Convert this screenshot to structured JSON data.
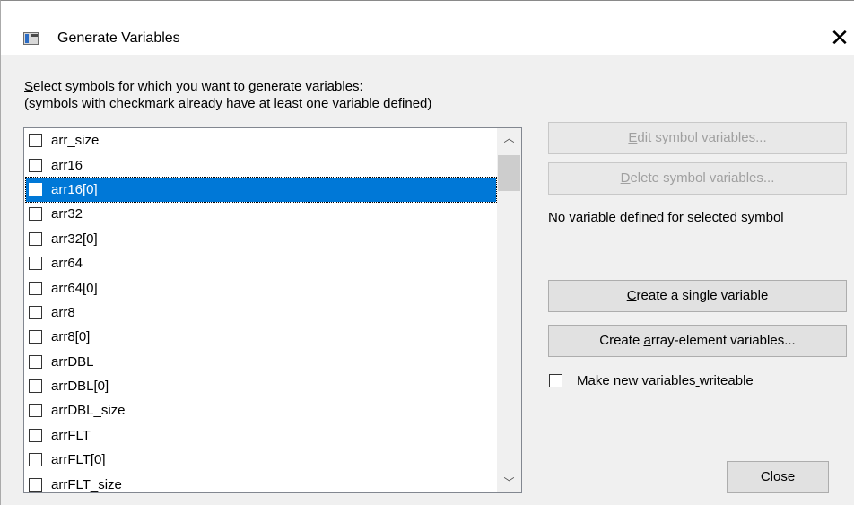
{
  "window": {
    "title": "Generate Variables",
    "close_glyph": "✕"
  },
  "instructions": {
    "line1": "Select symbols for which you want to generate variables:",
    "line2": "(symbols with checkmark already have at least one variable defined)"
  },
  "symbols": [
    {
      "label": "arr_size",
      "checked": false,
      "selected": false
    },
    {
      "label": "arr16",
      "checked": false,
      "selected": false
    },
    {
      "label": "arr16[0]",
      "checked": false,
      "selected": true
    },
    {
      "label": "arr32",
      "checked": false,
      "selected": false
    },
    {
      "label": "arr32[0]",
      "checked": false,
      "selected": false
    },
    {
      "label": "arr64",
      "checked": false,
      "selected": false
    },
    {
      "label": "arr64[0]",
      "checked": false,
      "selected": false
    },
    {
      "label": "arr8",
      "checked": false,
      "selected": false
    },
    {
      "label": "arr8[0]",
      "checked": false,
      "selected": false
    },
    {
      "label": "arrDBL",
      "checked": false,
      "selected": false
    },
    {
      "label": "arrDBL[0]",
      "checked": false,
      "selected": false
    },
    {
      "label": "arrDBL_size",
      "checked": false,
      "selected": false
    },
    {
      "label": "arrFLT",
      "checked": false,
      "selected": false
    },
    {
      "label": "arrFLT[0]",
      "checked": false,
      "selected": false
    },
    {
      "label": "arrFLT_size",
      "checked": false,
      "selected": false
    }
  ],
  "scrollbar": {
    "up_glyph": "︿",
    "down_glyph": "﹀"
  },
  "actions": {
    "edit_label": "Edit symbol variables...",
    "delete_label": "Delete symbol variables...",
    "status": "No variable defined for selected symbol",
    "single_label": "Create a single variable",
    "array_label": "Create array-element variables...",
    "writeable_label": "Make new variables writeable",
    "writeable_checked": false,
    "close_label": "Close"
  },
  "colors": {
    "selection": "#0078d7",
    "disabled_text": "#a0a0a0"
  }
}
